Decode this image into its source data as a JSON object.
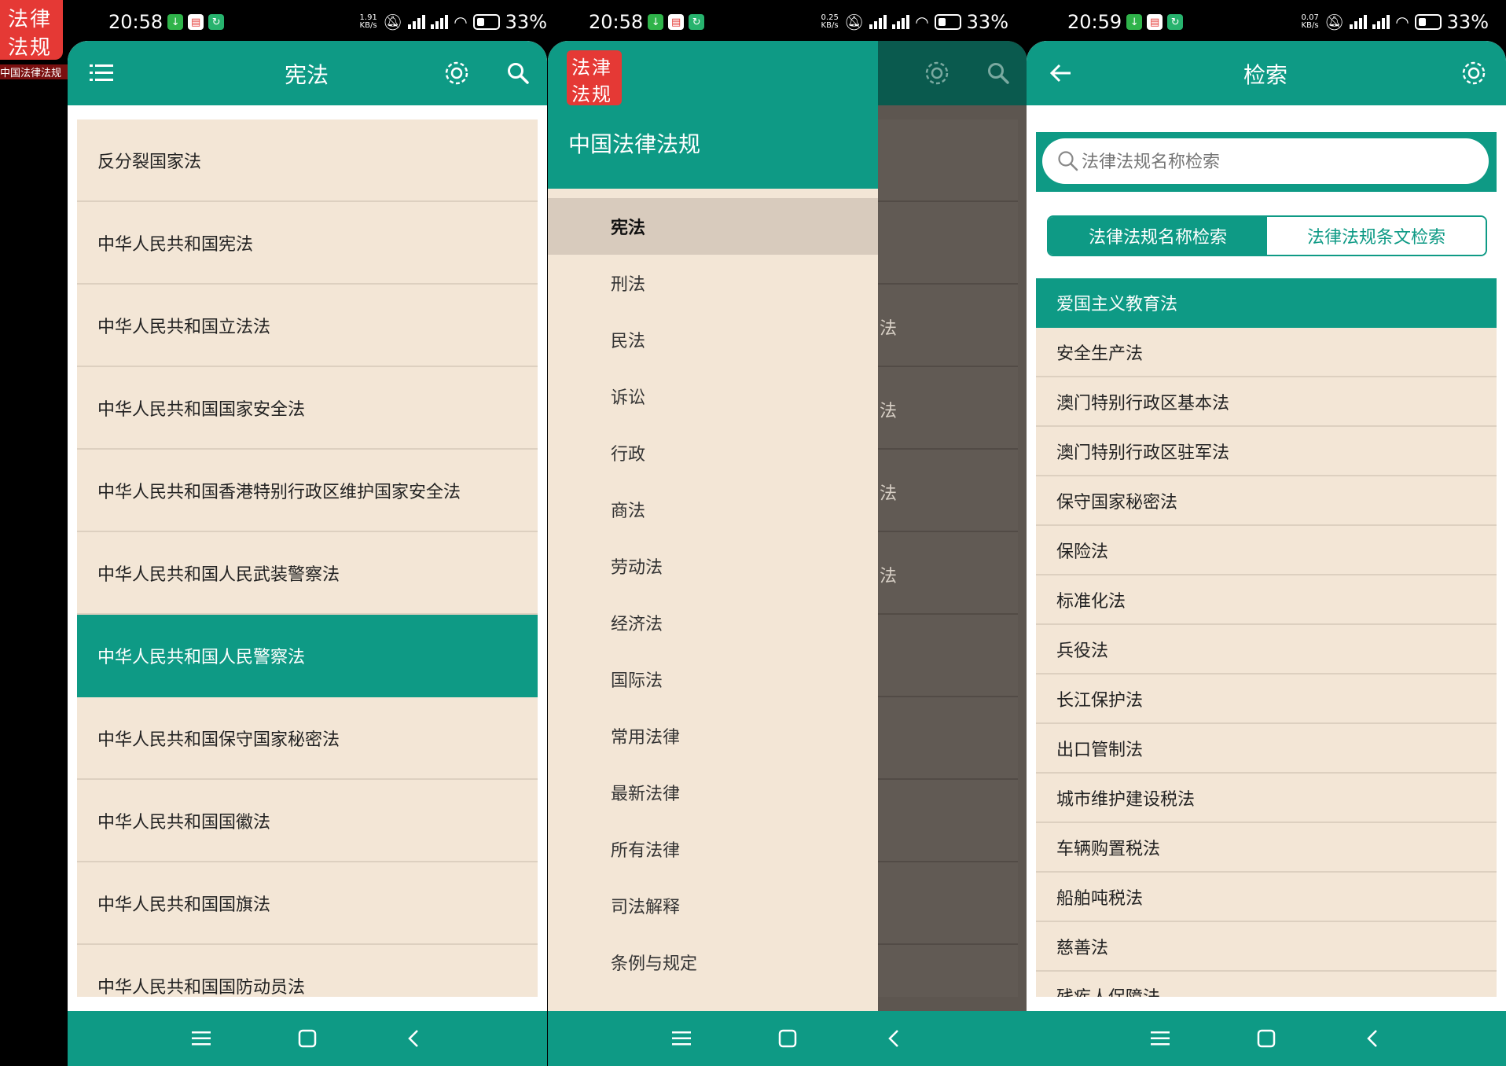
{
  "colors": {
    "primary": "#0e9a85",
    "list_bg": "#f3e6d6",
    "badge": "#e53935"
  },
  "badge": {
    "line1": "法律",
    "line2": "法规",
    "caption": "中国法律法规"
  },
  "screen1": {
    "status": {
      "time": "20:58",
      "speed_top": "1.91",
      "speed_bottom": "KB/s",
      "battery": "33%"
    },
    "appbar": {
      "title": "宪法",
      "menu_icon": "menu-icon",
      "settings_icon": "gear-icon",
      "search_icon": "search-icon"
    },
    "items": [
      "反分裂国家法",
      "中华人民共和国宪法",
      "中华人民共和国立法法",
      "中华人民共和国国家安全法",
      "中华人民共和国香港特别行政区维护国家安全法",
      "中华人民共和国人民武装警察法",
      "中华人民共和国人民警察法",
      "中华人民共和国保守国家秘密法",
      "中华人民共和国国徽法",
      "中华人民共和国国旗法",
      "中华人民共和国国防动员法"
    ],
    "selected_index": 6
  },
  "screen2": {
    "status": {
      "time": "20:58",
      "speed_top": "0.25",
      "speed_bottom": "KB/s",
      "battery": "33%"
    },
    "drawer": {
      "logo_line1": "法津",
      "logo_line2": "法规",
      "app_name": "中国法律法规",
      "items": [
        "宪法",
        "刑法",
        "民法",
        "诉讼",
        "行政",
        "商法",
        "劳动法",
        "经济法",
        "国际法",
        "常用法律",
        "最新法律",
        "所有法律",
        "司法解释",
        "条例与规定"
      ],
      "selected_index": 0
    },
    "behind_fragments": [
      "法",
      "法",
      "法",
      "法"
    ]
  },
  "screen3": {
    "status": {
      "time": "20:59",
      "speed_top": "0.07",
      "speed_bottom": "KB/s",
      "battery": "33%"
    },
    "appbar": {
      "title": "检索",
      "back_icon": "back-arrow-icon",
      "settings_icon": "gear-icon"
    },
    "search_placeholder": "法律法规名称检索",
    "tabs": [
      {
        "label": "法律法规名称检索",
        "active": true
      },
      {
        "label": "法律法规条文检索",
        "active": false
      }
    ],
    "items": [
      "爱国主义教育法",
      "安全生产法",
      "澳门特别行政区基本法",
      "澳门特别行政区驻军法",
      "保守国家秘密法",
      "保险法",
      "标准化法",
      "兵役法",
      "长江保护法",
      "出口管制法",
      "城市维护建设税法",
      "车辆购置税法",
      "船舶吨税法",
      "慈善法",
      "残疾人保障法"
    ],
    "selected_index": 0
  }
}
